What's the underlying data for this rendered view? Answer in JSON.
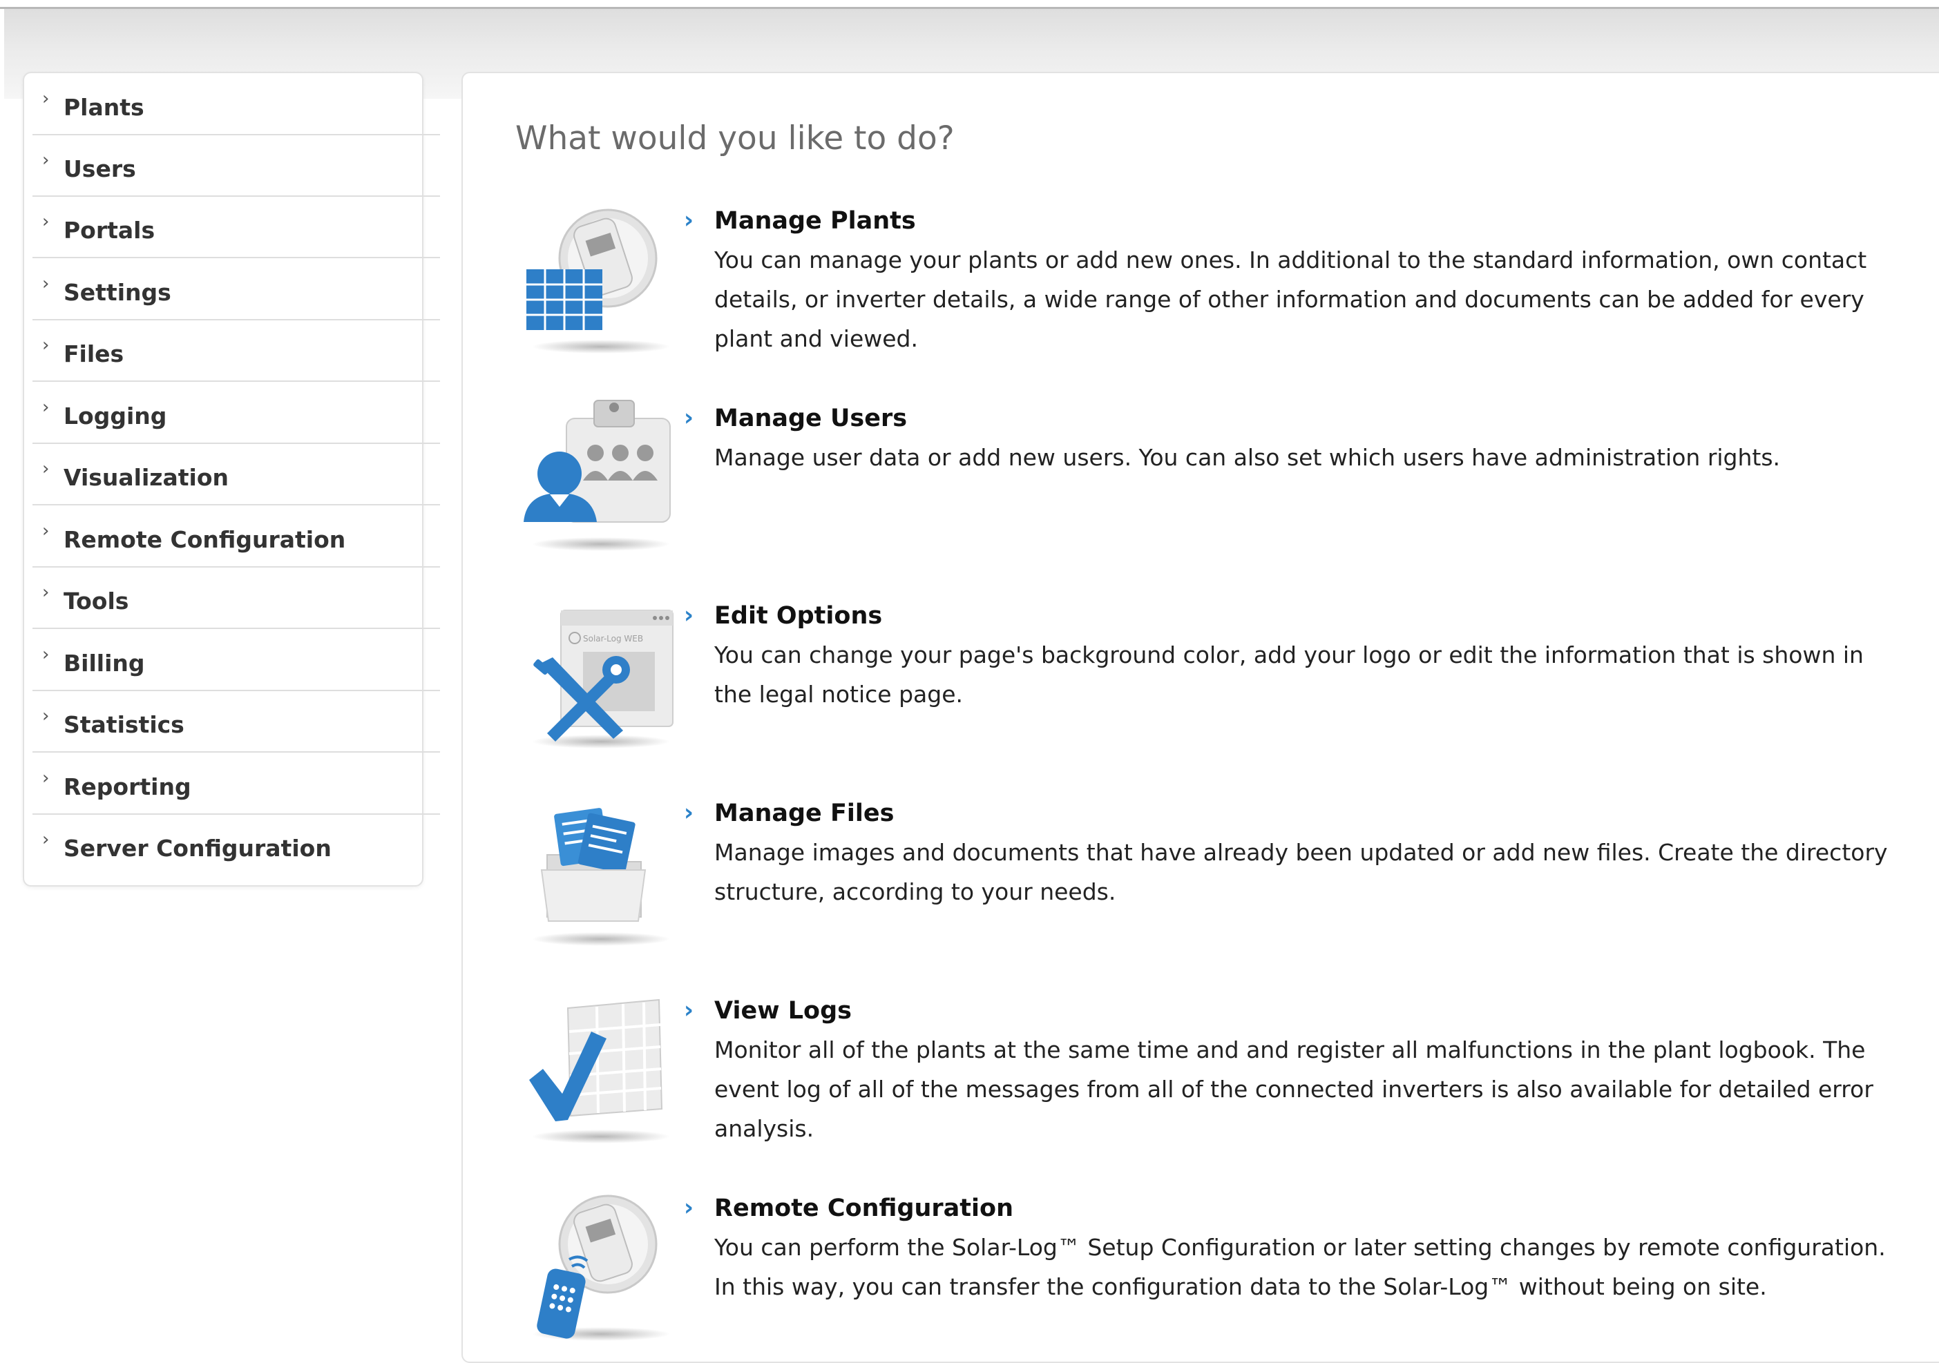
{
  "sidebar": {
    "items": [
      {
        "label": "Plants"
      },
      {
        "label": "Users"
      },
      {
        "label": "Portals"
      },
      {
        "label": "Settings"
      },
      {
        "label": "Files"
      },
      {
        "label": "Logging"
      },
      {
        "label": "Visualization"
      },
      {
        "label": "Remote Configuration"
      },
      {
        "label": "Tools"
      },
      {
        "label": "Billing"
      },
      {
        "label": "Statistics"
      },
      {
        "label": "Reporting"
      },
      {
        "label": "Server Configuration"
      }
    ],
    "chevron": "›"
  },
  "main": {
    "title": "What would you like to do?",
    "chevron": "›",
    "actions": [
      {
        "icon": "plant-inverter-icon",
        "title": "Manage Plants",
        "description": "You can manage your plants or add new ones. In additional to the standard information, own contact details, or inverter details, a wide range of other information and documents can be added for every plant and viewed."
      },
      {
        "icon": "users-icon",
        "title": "Manage Users",
        "description": "Manage user data or add new users. You can also set which users have administration rights."
      },
      {
        "icon": "tools-icon",
        "title": "Edit Options",
        "description": "You can change your page's background color, add your logo or edit the information that is shown in the legal notice page."
      },
      {
        "icon": "folder-documents-icon",
        "title": "Manage Files",
        "description": "Manage images and documents that have already been updated or add new files. Create the directory structure, according to your needs."
      },
      {
        "icon": "checkmark-log-icon",
        "title": "View Logs",
        "description": "Monitor all of the plants at the same time and and register all malfunctions in the plant logbook. The event log of all of the messages from all of the connected inverters is also available for detailed error analysis."
      },
      {
        "icon": "remote-control-icon",
        "title": "Remote Configuration",
        "description": "You can perform the Solar-Log™ Setup Configuration or later setting changes by remote configuration. In this way, you can transfer the configuration data to the Solar-Log™ without being on site."
      }
    ]
  },
  "icons": {
    "options_browser_text": "Solar-Log WEB"
  },
  "colors": {
    "accent_blue": "#2b82c9",
    "icon_blue": "#3a8fd6",
    "title_gray": "#6b6b6b",
    "border_gray": "#e2e2e2"
  }
}
